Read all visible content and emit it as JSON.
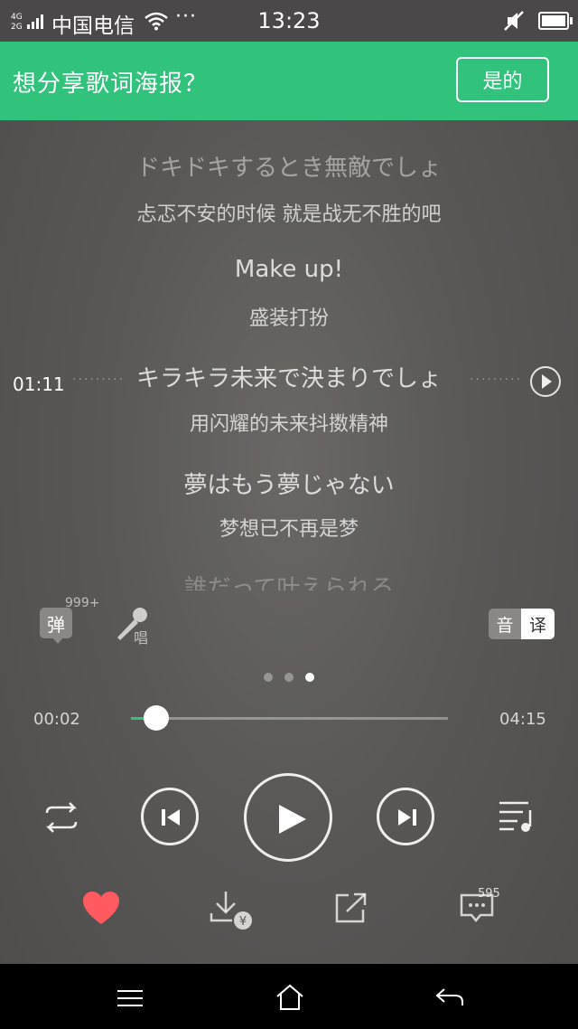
{
  "status_bar": {
    "network": "4G 2G",
    "carrier": "中国电信",
    "more": "···",
    "time": "13:23"
  },
  "share_banner": {
    "text": "想分享歌词海报？",
    "button_label": "是的"
  },
  "lyrics": [
    {
      "original": "ドキドキするとき無敵でしょ",
      "translation": "忐忑不安的时候 就是战无不胜的吧"
    },
    {
      "original": "Make up!",
      "translation": "盛装打扮"
    },
    {
      "original": "キラキラ未来で決まりでしょ",
      "translation": "用闪耀的未来抖擞精神"
    },
    {
      "original": "夢はもう夢じゃない",
      "translation": "梦想已不再是梦"
    },
    {
      "original": "誰だって叶えられる",
      "translation": ""
    }
  ],
  "seek_indicator": {
    "time": "01:11",
    "dots": "·········"
  },
  "tools": {
    "danmaku_label": "弹",
    "danmaku_count": "999+",
    "sing_label": "唱",
    "pron_label": "音",
    "translate_label": "译"
  },
  "pager": {
    "count": 3,
    "active_index": 2
  },
  "progress": {
    "current": "00:02",
    "total": "04:15",
    "fraction": 0.04
  },
  "controls": {
    "repeat": "repeat-icon",
    "prev": "skip-previous-icon",
    "play": "play-icon",
    "next": "skip-next-icon",
    "playlist": "playlist-icon"
  },
  "actions": {
    "like": "heart-icon",
    "download": "download-paid-icon",
    "share": "share-icon",
    "comment": "comment-icon",
    "comment_count": "595"
  },
  "colors": {
    "accent": "#31c27c",
    "heart": "#ff5a5f"
  },
  "nav_bar": {
    "menu": "menu-icon",
    "home": "home-icon",
    "back": "back-icon"
  }
}
